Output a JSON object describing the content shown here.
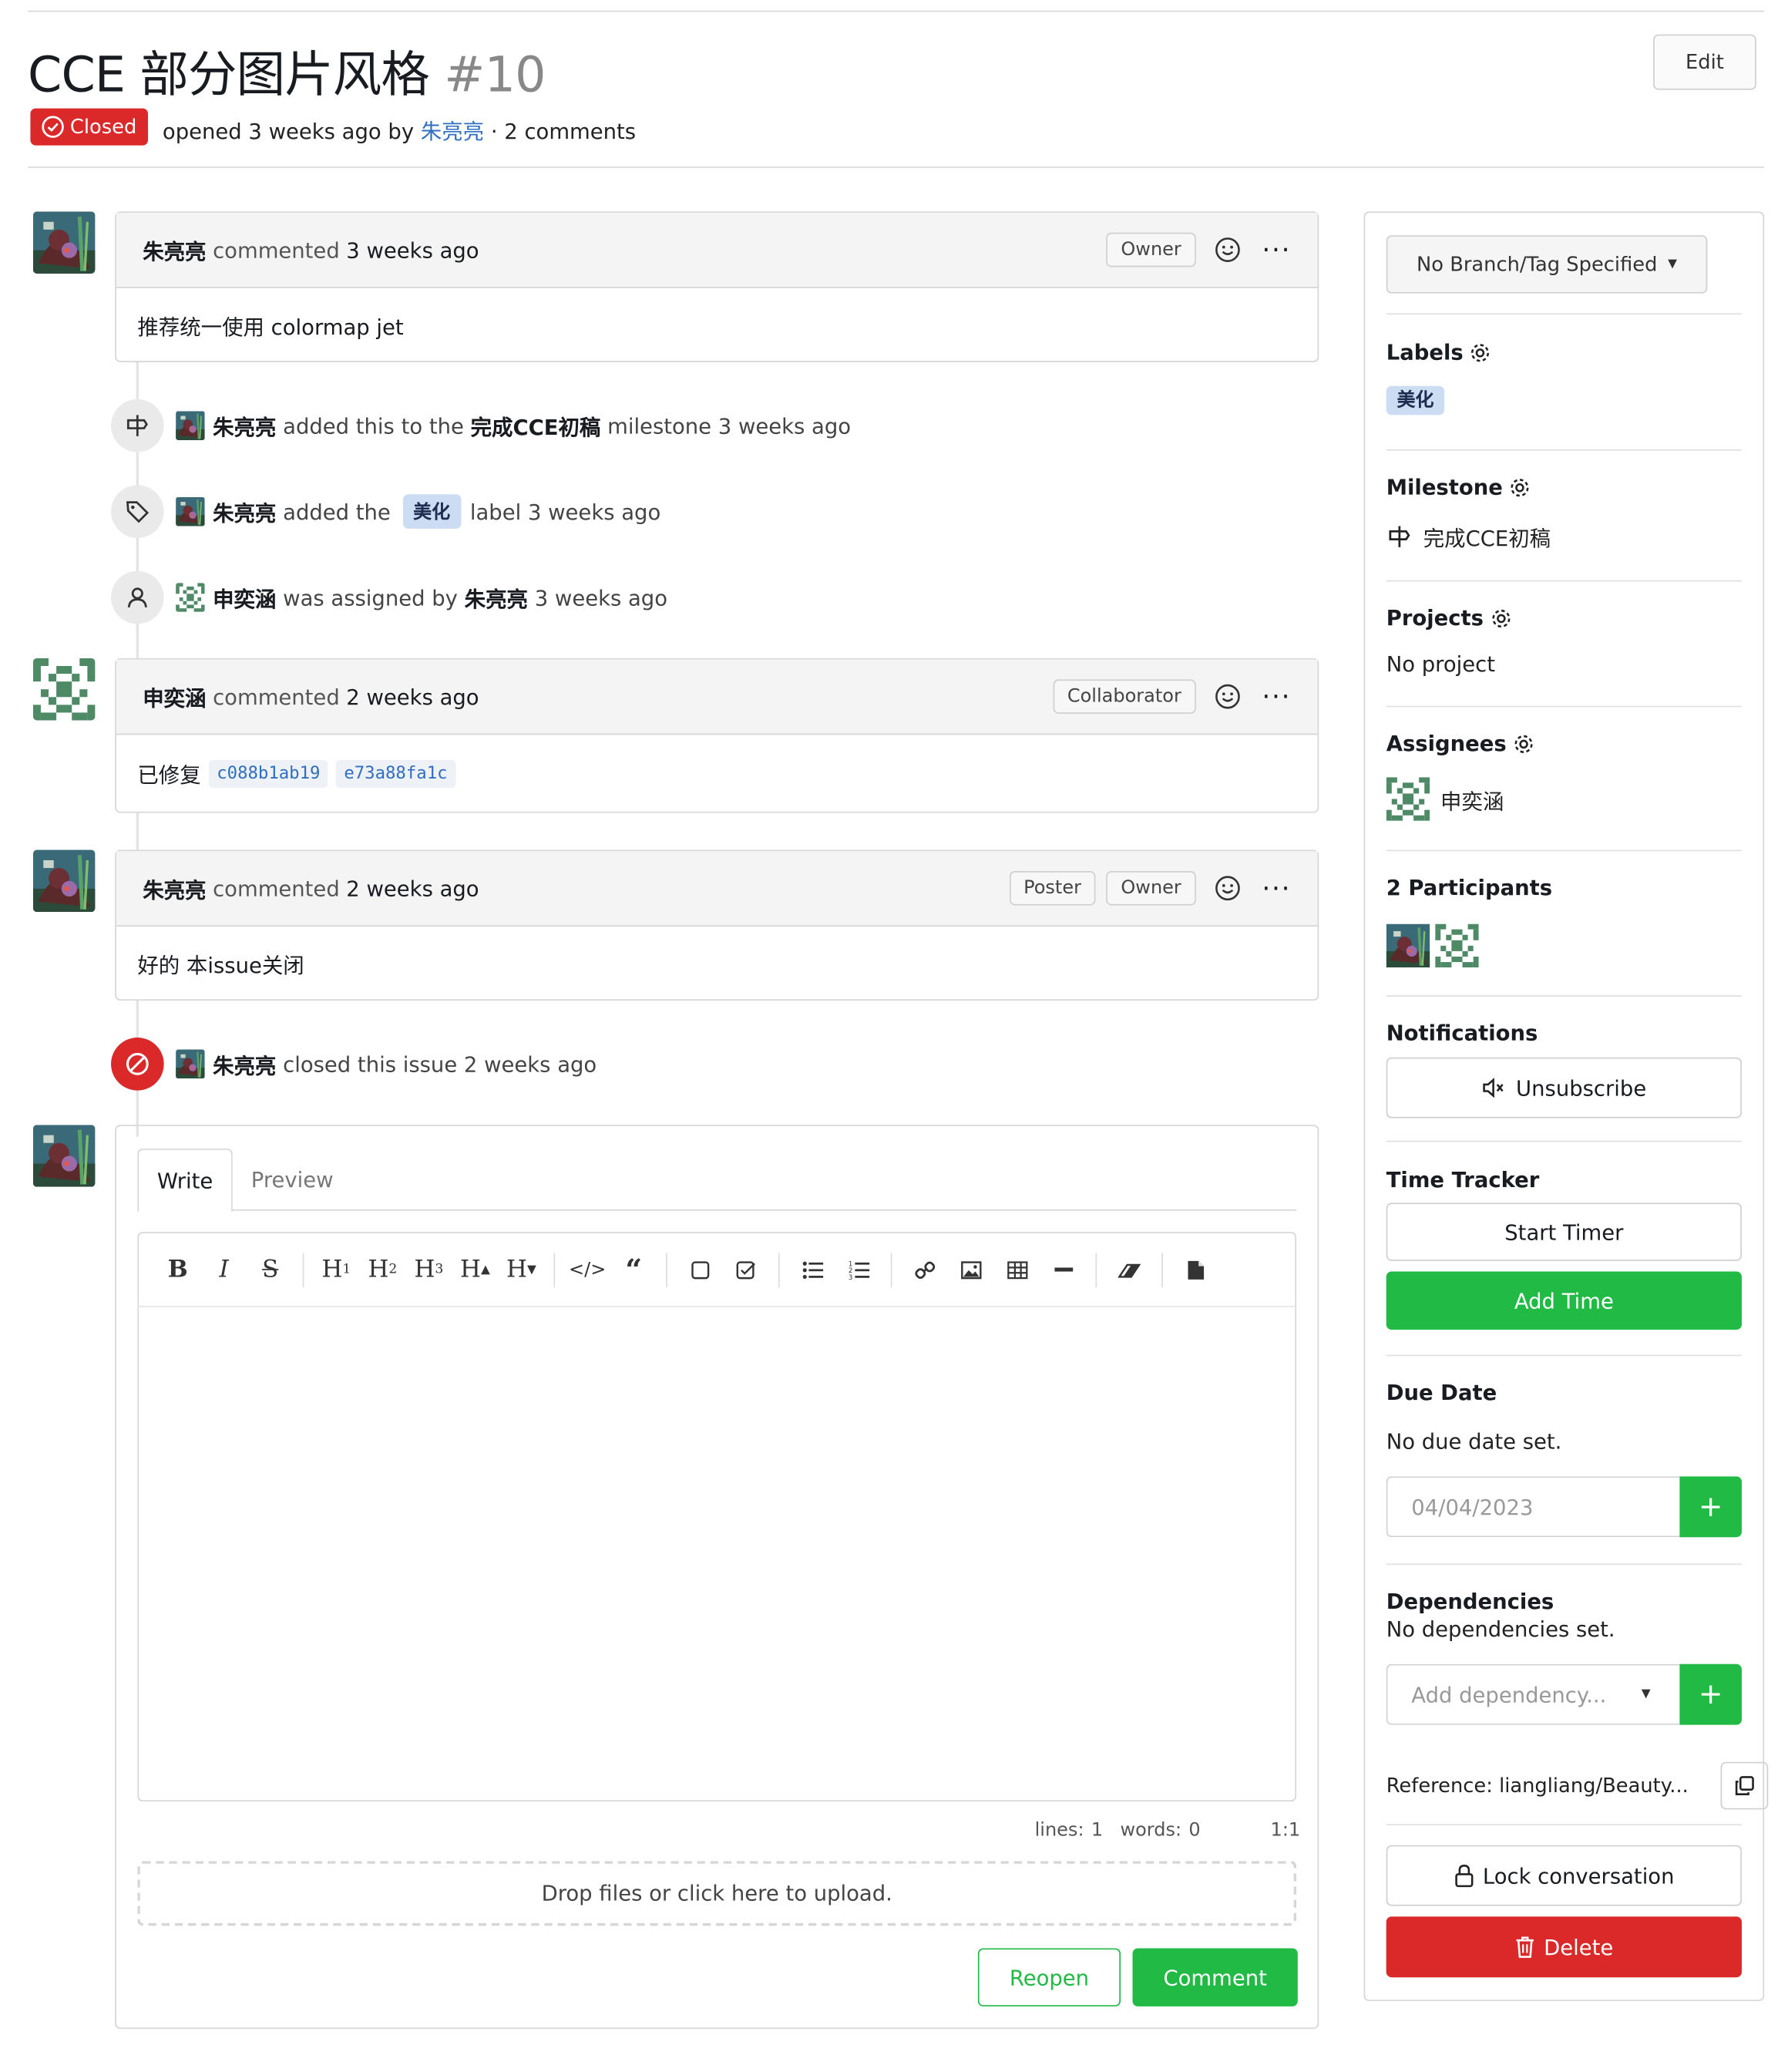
{
  "issue": {
    "title": "CCE 部分图片风格",
    "number": "#10",
    "state": "Closed",
    "meta_prefix": "opened 3 weeks ago by",
    "author": "朱亮亮",
    "meta_suffix": "· 2 comments",
    "edit_label": "Edit"
  },
  "timeline": {
    "comment1": {
      "user": "朱亮亮",
      "action": "commented",
      "time": "3 weeks ago",
      "roles": [
        "Owner"
      ],
      "body": "推荐统一使用 colormap jet"
    },
    "event_milestone": {
      "user": "朱亮亮",
      "text_a": "added this to the",
      "milestone": "完成CCE初稿",
      "text_b": "milestone 3 weeks ago"
    },
    "event_label": {
      "user": "朱亮亮",
      "text_a": "added the",
      "label": "美化",
      "text_b": "label 3 weeks ago"
    },
    "event_assign": {
      "user": "申奕涵",
      "text_a": "was assigned by",
      "by": "朱亮亮",
      "time": "3 weeks ago"
    },
    "comment2": {
      "user": "申奕涵",
      "action": "commented",
      "time": "2 weeks ago",
      "roles": [
        "Collaborator"
      ],
      "body": "已修复",
      "commits": [
        "c088b1ab19",
        "e73a88fa1c"
      ]
    },
    "comment3": {
      "user": "朱亮亮",
      "action": "commented",
      "time": "2 weeks ago",
      "roles": [
        "Poster",
        "Owner"
      ],
      "body": "好的 本issue关闭"
    },
    "event_closed": {
      "user": "朱亮亮",
      "text": "closed this issue 2 weeks ago"
    }
  },
  "editor": {
    "tabs": [
      "Write",
      "Preview"
    ],
    "toolbar": [
      "bold-icon",
      "italic-icon",
      "strikethrough-icon",
      "heading-1-icon",
      "heading-2-icon",
      "heading-3-icon",
      "heading-bigger-icon",
      "heading-smaller-icon",
      "code-icon",
      "quote-icon",
      "checkbox-empty-icon",
      "checkbox-checked-icon",
      "unordered-list-icon",
      "ordered-list-icon",
      "link-icon",
      "image-icon",
      "table-icon",
      "horizontal-rule-icon",
      "eraser-icon",
      "file-icon"
    ],
    "lines": "lines: 1",
    "words": "words: 0",
    "cursor": "1:1",
    "dropzone": "Drop files or click here to upload.",
    "reopen_label": "Reopen",
    "comment_label": "Comment"
  },
  "sidebar": {
    "branch": "No Branch/Tag Specified",
    "labels_title": "Labels",
    "label": "美化",
    "milestone_title": "Milestone",
    "milestone": "完成CCE初稿",
    "projects_title": "Projects",
    "projects_value": "No project",
    "assignees_title": "Assignees",
    "assignee": "申奕涵",
    "participants_title": "2 Participants",
    "notifications_title": "Notifications",
    "unsubscribe": "Unsubscribe",
    "time_tracker_title": "Time Tracker",
    "start_timer": "Start Timer",
    "add_time": "Add Time",
    "due_date_title": "Due Date",
    "due_date_value": "No due date set.",
    "date_placeholder": "04/04/2023",
    "dependencies_title": "Dependencies",
    "dependencies_value": "No dependencies set.",
    "add_dependency": "Add dependency...",
    "reference": "Reference: liangliang/Beauty...",
    "lock": "Lock conversation",
    "delete": "Delete"
  },
  "colors": {
    "closed_red": "#db2828",
    "green": "#21ba45",
    "link_blue": "#2f6fc2",
    "label_bg": "#cbdcf3"
  }
}
